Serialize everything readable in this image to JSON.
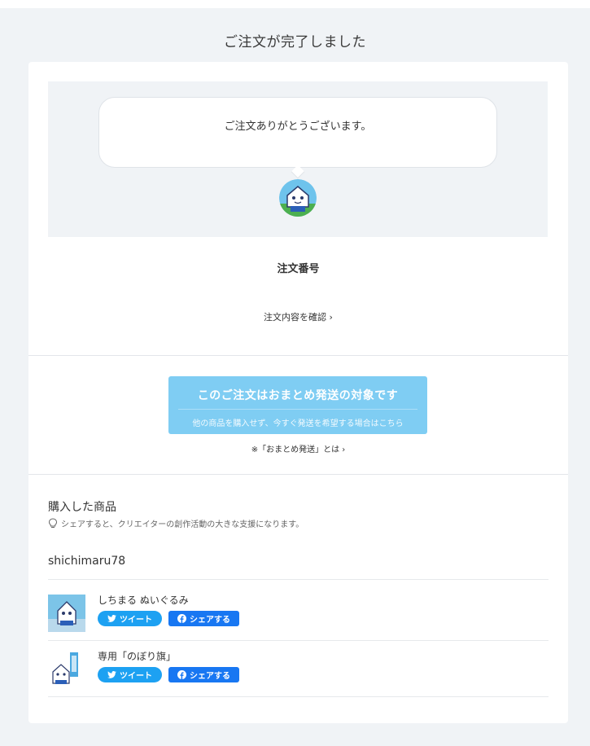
{
  "page": {
    "title": "ご注文が完了しました"
  },
  "hero": {
    "message": "ご注文ありがとうございます。"
  },
  "order": {
    "number_label": "注文番号",
    "confirm_link": "注文内容を確認 ›"
  },
  "bundle": {
    "title": "このご注文はおまとめ発送の対象です",
    "subtitle": "他の商品を購入せず、今すぐ発送を希望する場合はこちら",
    "info_link": "※「おまとめ発送」とは ›"
  },
  "purchased": {
    "title": "購入した商品",
    "hint": "シェアすると、クリエイターの創作活動の大きな支援になります。",
    "shop_name": "shichimaru78",
    "items": [
      {
        "name": "しちまる ぬいぐるみ",
        "tweet_label": "ツイート",
        "share_label": "シェアする"
      },
      {
        "name": "専用「のぼり旗」",
        "tweet_label": "ツイート",
        "share_label": "シェアする"
      }
    ]
  },
  "colors": {
    "background": "#f0f3f6",
    "bundle_button": "#7fcdf3",
    "twitter": "#1da1f2",
    "facebook": "#1877f2"
  }
}
